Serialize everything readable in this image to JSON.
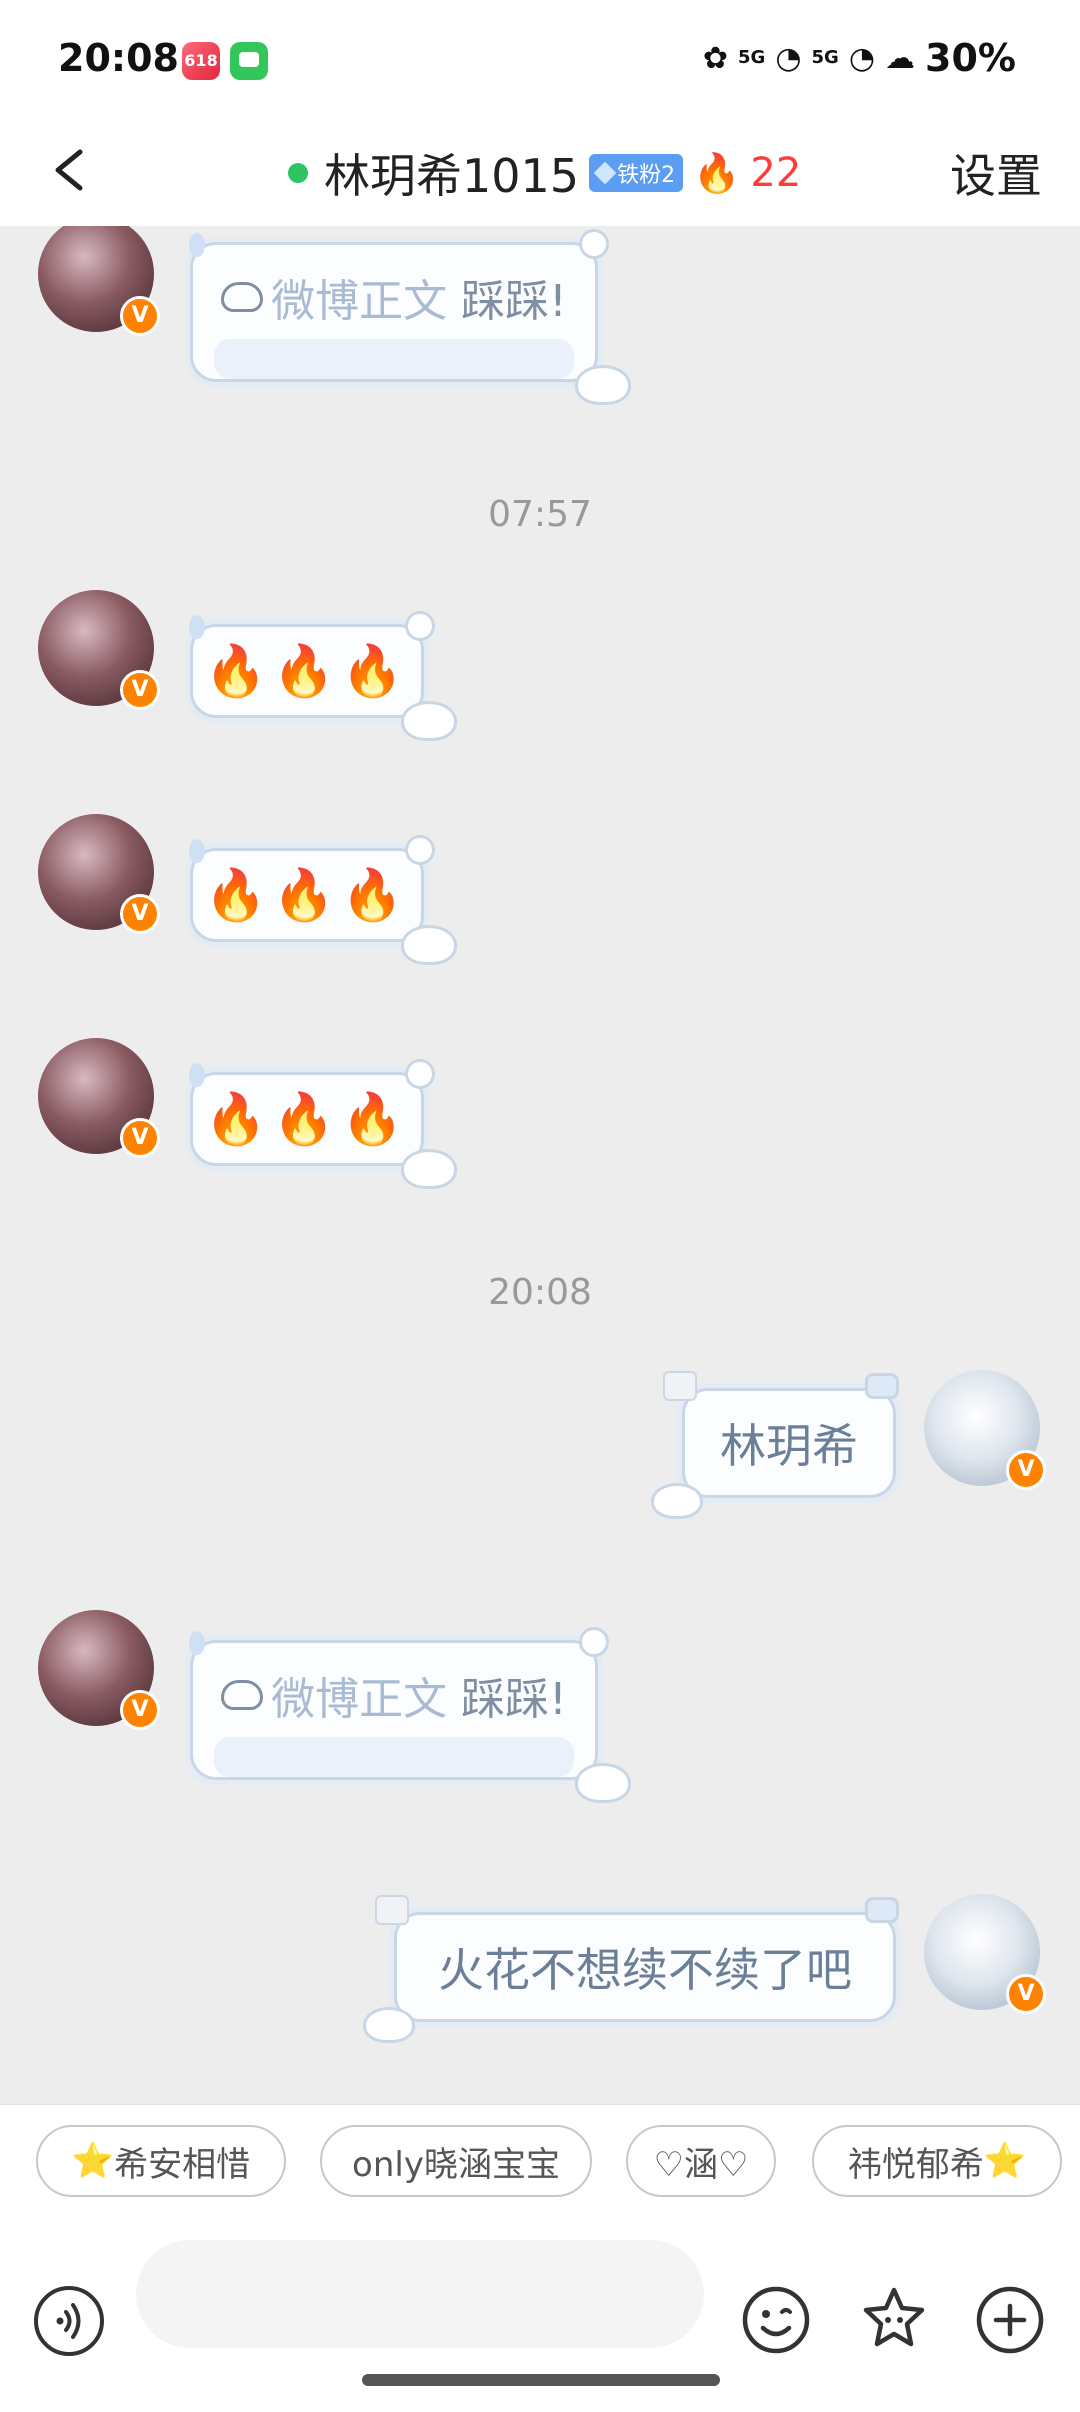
{
  "status_bar": {
    "time": "20:08",
    "notif_app_1_label": "618",
    "network_1": "5G",
    "network_2": "5G",
    "battery": "30%"
  },
  "header": {
    "title": "林玥希1015",
    "fan_badge": "铁粉2",
    "fire_count": "22",
    "settings_label": "设置"
  },
  "chat": {
    "timestamps": [
      "07:57",
      "20:08"
    ],
    "messages": [
      {
        "side": "left",
        "type": "weibo_card",
        "label": "微博正文",
        "text": "踩踩!"
      },
      {
        "side": "left",
        "type": "emoji",
        "text": "🔥🔥🔥"
      },
      {
        "side": "left",
        "type": "emoji",
        "text": "🔥🔥🔥"
      },
      {
        "side": "left",
        "type": "emoji",
        "text": "🔥🔥🔥"
      },
      {
        "side": "right",
        "type": "text",
        "text": "林玥希"
      },
      {
        "side": "left",
        "type": "weibo_card",
        "label": "微博正文",
        "text": "踩踩!"
      },
      {
        "side": "right",
        "type": "text",
        "text": "火花不想续不续了吧"
      }
    ]
  },
  "quick_replies": [
    {
      "prefix": "⭐",
      "text": "希安相惜",
      "suffix": ""
    },
    {
      "prefix": "",
      "text": "only晓涵宝宝",
      "suffix": ""
    },
    {
      "prefix": "",
      "text": "♡涵♡",
      "suffix": ""
    },
    {
      "prefix": "",
      "text": "祎悦郁希",
      "suffix": "⭐"
    }
  ],
  "input_bar": {
    "placeholder": "",
    "icons": [
      "voice-icon",
      "emoji-icon",
      "sticker-icon",
      "add-icon"
    ]
  },
  "colors": {
    "online": "#2fc463",
    "fire_count": "#ff3b3b",
    "verified_badge": "#ff8200",
    "bubble_border": "#c9d6e6",
    "fan_badge": "#5b9df2"
  }
}
